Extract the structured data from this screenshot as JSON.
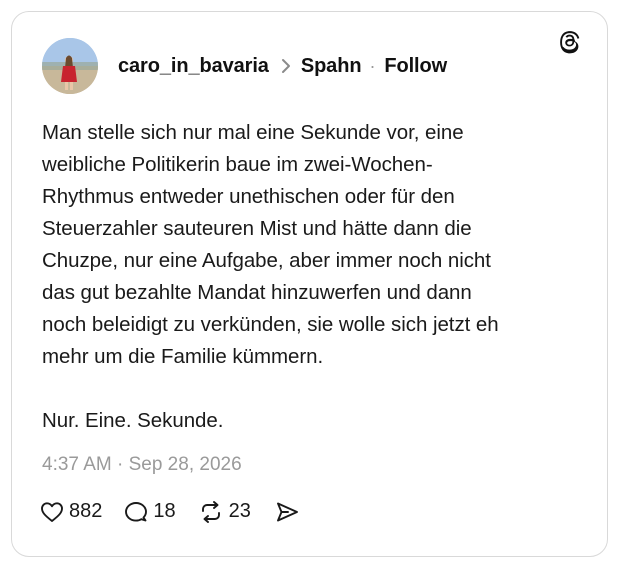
{
  "post": {
    "author": "caro_in_bavaria",
    "reply_to": "Spahn",
    "follow_label": "Follow",
    "text": "Man stelle sich nur mal eine Sekunde vor, eine\nweibliche Politikerin baue im zwei-Wochen-\nRhythmus entweder unethischen oder für den\nSteuerzahler sauteuren Mist und hätte dann die\nChuzpe, nur eine Aufgabe, aber immer noch nicht\ndas gut bezahlte Mandat hinzuwerfen und dann\nnoch beleidigt zu verkünden, sie wolle sich jetzt eh\nmehr um die Familie kümmern.\n\nNur. Eine. Sekunde.",
    "timestamp": "4:37 AM · Sep 28, 2026"
  },
  "stats": {
    "likes": "882",
    "replies": "18",
    "reposts": "23"
  },
  "icons": {
    "logo": "threads-logo-icon",
    "chevron": "chevron-right-icon",
    "like": "heart-icon",
    "reply": "speech-bubble-icon",
    "repost": "repost-icon",
    "share": "send-icon"
  },
  "colors": {
    "text": "#111111",
    "muted": "#9a9a9a",
    "border": "#d9d9d9"
  }
}
